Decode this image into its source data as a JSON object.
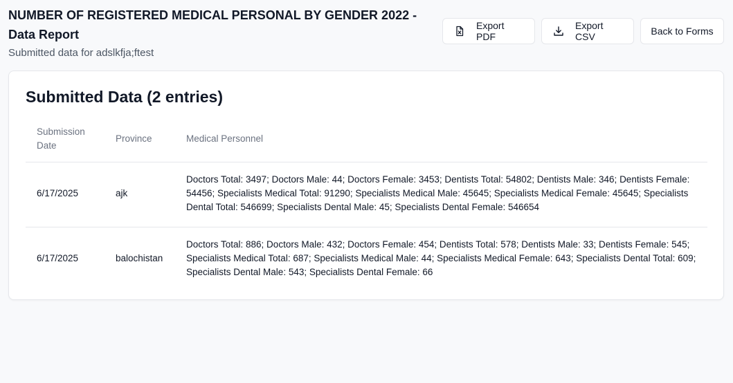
{
  "header": {
    "title": "NUMBER OF REGISTERED MEDICAL PERSONAL BY GENDER 2022 - Data Report",
    "subtitle": "Submitted data for adslkfja;ftest"
  },
  "actions": {
    "export_pdf": "Export PDF",
    "export_csv": "Export CSV",
    "back": "Back to Forms"
  },
  "card": {
    "title": "Submitted Data (2 entries)"
  },
  "table": {
    "columns": [
      "Submission Date",
      "Province",
      "Medical Personnel"
    ],
    "rows": [
      {
        "date": "6/17/2025",
        "province": "ajk",
        "personnel": "Doctors Total: 3497; Doctors Male: 44; Doctors Female: 3453; Dentists Total: 54802; Dentists Male: 346; Dentists Female: 54456; Specialists Medical Total: 91290; Specialists Medical Male: 45645; Specialists Medical Female: 45645; Specialists Dental Total: 546699; Specialists Dental Male: 45; Specialists Dental Female: 546654"
      },
      {
        "date": "6/17/2025",
        "province": "balochistan",
        "personnel": "Doctors Total: 886; Doctors Male: 432; Doctors Female: 454; Dentists Total: 578; Dentists Male: 33; Dentists Female: 545; Specialists Medical Total: 687; Specialists Medical Male: 44; Specialists Medical Female: 643; Specialists Dental Total: 609; Specialists Dental Male: 543; Specialists Dental Female: 66"
      }
    ]
  },
  "icons": {
    "export_pdf": "file-x-icon",
    "export_csv": "download-icon"
  }
}
